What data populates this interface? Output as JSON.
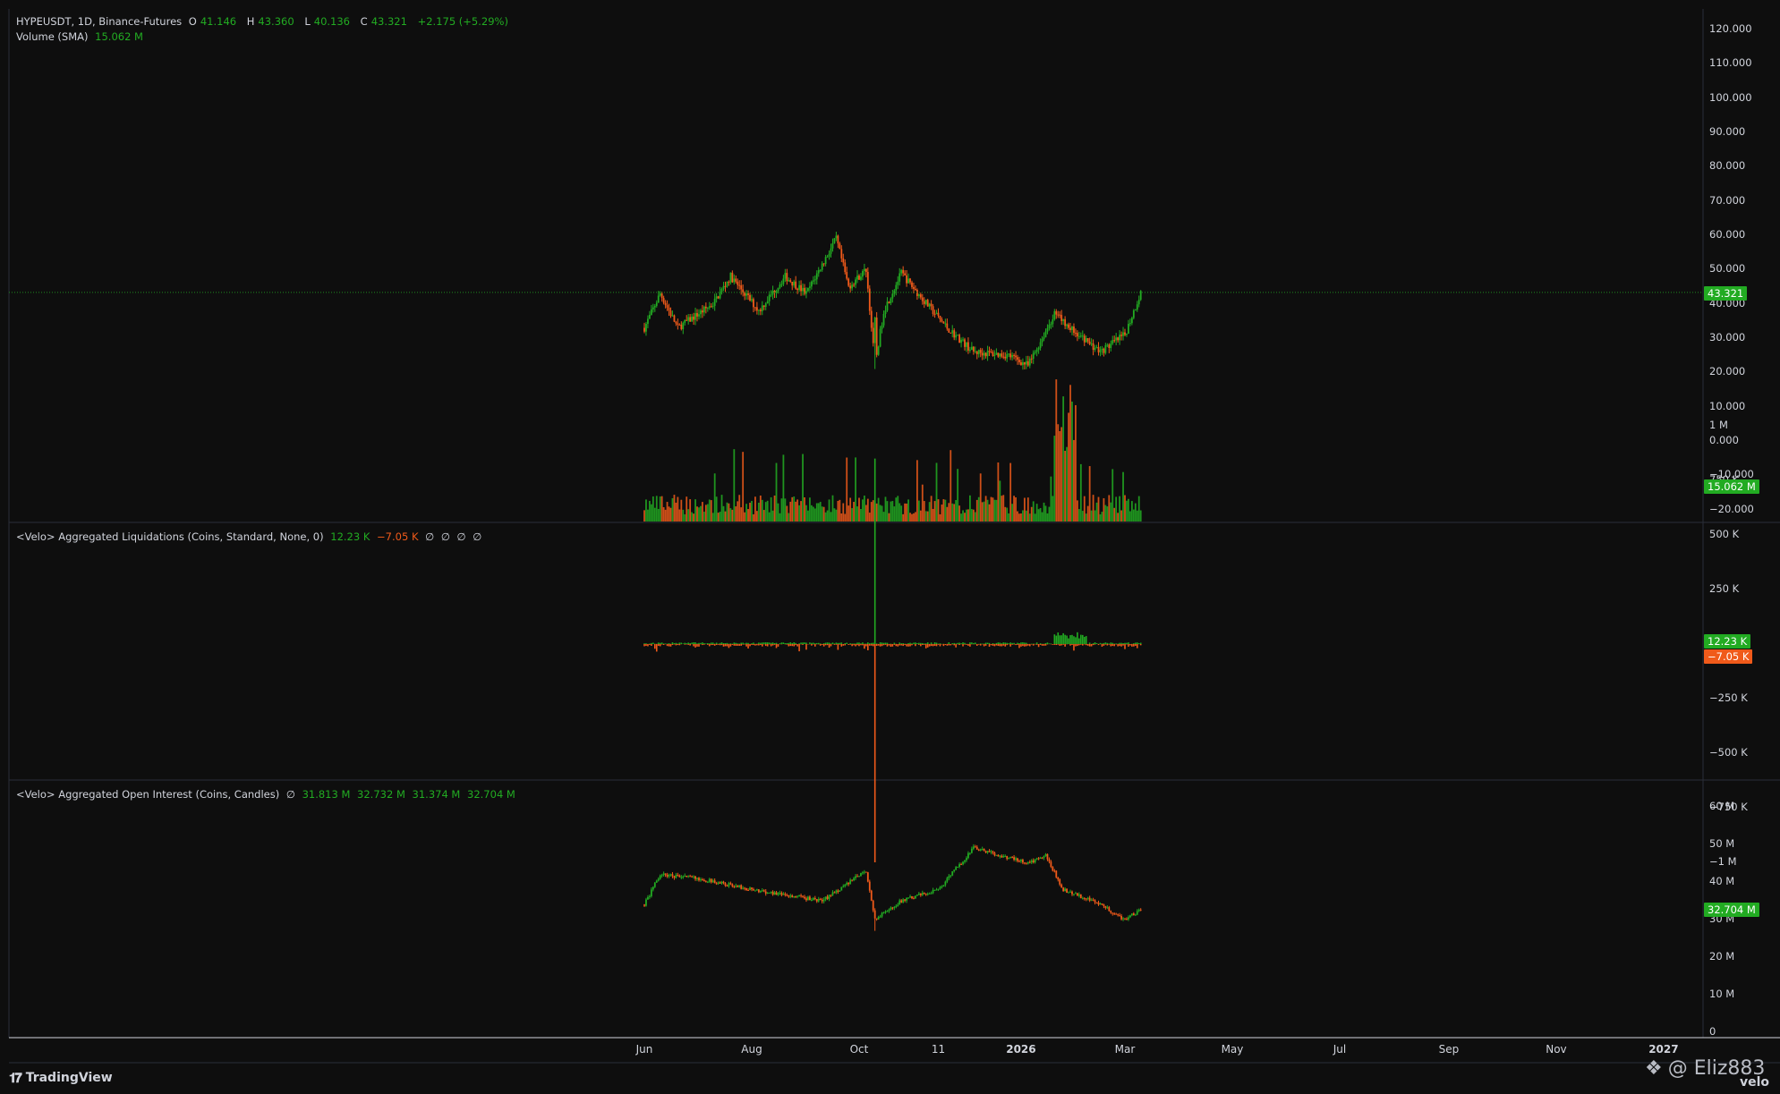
{
  "colors": {
    "up": "#22ab22",
    "down": "#f05a1a",
    "bg": "#0e0e0e",
    "grid": "#2a2e39",
    "text": "#d1d4dc",
    "priceLine": "#1f8a1f"
  },
  "main": {
    "symbol": "HYPEUSDT, 1D, Binance-Futures",
    "o_label": "O",
    "o": "41.146",
    "h_label": "H",
    "h": "43.360",
    "l_label": "L",
    "l": "40.136",
    "c_label": "C",
    "c": "43.321",
    "change": "+2.175 (+5.29%)",
    "volume_label": "Volume (SMA)",
    "volume_value": "15.062 M",
    "price_tag": "43.321",
    "volume_tag": "15.062 M",
    "axis": [
      "120.000",
      "110.000",
      "100.000",
      "90.000",
      "80.000",
      "70.000",
      "60.000",
      "50.000",
      "40.000",
      "30.000",
      "20.000",
      "10.000",
      "0.000",
      "−10.000",
      "−20.000"
    ]
  },
  "liquidations": {
    "title": "<Velo> Aggregated Liquidations (Coins, Standard, None, 0)",
    "long_value": "12.23 K",
    "short_value": "−7.05 K",
    "nulls": [
      "∅",
      "∅",
      "∅",
      "∅"
    ],
    "axis": [
      "1 M",
      "750 K",
      "500 K",
      "250 K",
      "−250 K",
      "−500 K",
      "−750 K",
      "−1 M"
    ],
    "long_tag": "12.23 K",
    "short_tag": "−7.05 K"
  },
  "open_interest": {
    "title": "<Velo> Aggregated Open Interest (Coins, Candles)",
    "null_sign": "∅",
    "o": "31.813 M",
    "h": "32.732 M",
    "l": "31.374 M",
    "c": "32.704 M",
    "axis": [
      "60 M",
      "50 M",
      "40 M",
      "30 M",
      "20 M",
      "10 M",
      "0"
    ],
    "tag": "32.704 M"
  },
  "time_axis": [
    "Jun",
    "Aug",
    "Oct",
    "11",
    "2026",
    "Mar",
    "May",
    "Jul",
    "Sep",
    "Nov",
    "2027"
  ],
  "branding": {
    "logo": "TradingView",
    "watermark": "@ Eliz883",
    "velo": "velo"
  },
  "chart_data": [
    {
      "type": "candlestick",
      "title": "HYPEUSDT, 1D, Binance-Futures",
      "x": "dates, Jun 2025 – Mar 2026",
      "ylim": [
        -20,
        120
      ],
      "close_path": [
        [
          "2025-06-01",
          33
        ],
        [
          "2025-06-10",
          43
        ],
        [
          "2025-06-20",
          33
        ],
        [
          "2025-07-10",
          40
        ],
        [
          "2025-07-20",
          48
        ],
        [
          "2025-08-05",
          38
        ],
        [
          "2025-08-20",
          48
        ],
        [
          "2025-09-01",
          43
        ],
        [
          "2025-09-18",
          59
        ],
        [
          "2025-09-25",
          45
        ],
        [
          "2025-10-05",
          50
        ],
        [
          "2025-10-10",
          22
        ],
        [
          "2025-10-15",
          38
        ],
        [
          "2025-10-25",
          49
        ],
        [
          "2025-11-05",
          42
        ],
        [
          "2025-11-20",
          33
        ],
        [
          "2025-12-05",
          26
        ],
        [
          "2025-12-25",
          25
        ],
        [
          "2026-01-05",
          22
        ],
        [
          "2026-01-20",
          37
        ],
        [
          "2026-02-05",
          30
        ],
        [
          "2026-02-15",
          26
        ],
        [
          "2026-03-01",
          31
        ],
        [
          "2026-03-10",
          43.3
        ]
      ]
    },
    {
      "type": "bar",
      "title": "Volume (SMA)",
      "last": 15.062
    },
    {
      "type": "bar",
      "title": "<Velo> Aggregated Liquidations (Coins, Standard, None, 0)",
      "ylim": [
        -1000000,
        1000000
      ],
      "spikes": [
        [
          "2025-10-10",
          850000,
          -1000000
        ],
        [
          "2026-01-20",
          50000,
          -20000
        ]
      ]
    },
    {
      "type": "candlestick",
      "title": "<Velo> Aggregated Open Interest (Coins, Candles)",
      "ylim": [
        0,
        60
      ],
      "close_path": [
        [
          "2025-06-01",
          34
        ],
        [
          "2025-06-10",
          42
        ],
        [
          "2025-07-01",
          41
        ],
        [
          "2025-08-01",
          38
        ],
        [
          "2025-09-10",
          35
        ],
        [
          "2025-10-05",
          43
        ],
        [
          "2025-10-10",
          30
        ],
        [
          "2025-10-25",
          35
        ],
        [
          "2025-11-15",
          38
        ],
        [
          "2025-12-05",
          49
        ],
        [
          "2026-01-05",
          45
        ],
        [
          "2026-01-15",
          47
        ],
        [
          "2026-01-25",
          38
        ],
        [
          "2026-02-15",
          34
        ],
        [
          "2026-03-01",
          30
        ],
        [
          "2026-03-10",
          32.7
        ]
      ]
    }
  ]
}
